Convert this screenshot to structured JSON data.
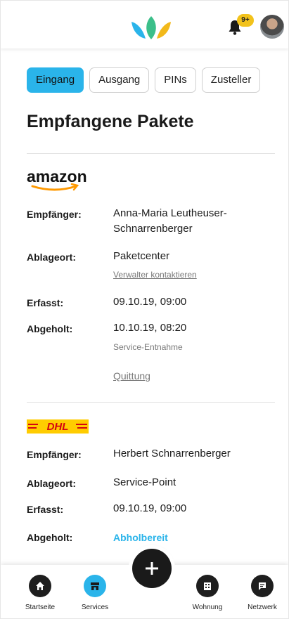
{
  "header": {
    "notification_badge": "9+",
    "icons": [
      "lotus-logo",
      "bell-icon",
      "avatar"
    ]
  },
  "tabs": [
    {
      "label": "Eingang",
      "active": true
    },
    {
      "label": "Ausgang",
      "active": false
    },
    {
      "label": "PINs",
      "active": false
    },
    {
      "label": "Zusteller",
      "active": false
    }
  ],
  "page_title": "Empfangene Pakete",
  "packages": [
    {
      "brand": "amazon",
      "recipient_label": "Empfänger:",
      "recipient": "Anna-Maria Leutheuser-Schnarrenberger",
      "location_label": "Ablageort:",
      "location": "Paketcenter",
      "location_link": "Verwalter kontaktieren",
      "recorded_label": "Erfasst:",
      "recorded": "09.10.19, 09:00",
      "picked_label": "Abgeholt:",
      "picked": "10.10.19, 08:20",
      "picked_note": "Service-Entnahme",
      "receipt_link": "Quittung"
    },
    {
      "brand": "DHL",
      "recipient_label": "Empfänger:",
      "recipient": "Herbert Schnarrenberger",
      "location_label": "Ablageort:",
      "location": "Service-Point",
      "recorded_label": "Erfasst:",
      "recorded": "09.10.19, 09:00",
      "picked_label": "Abgeholt:",
      "status": "Abholbereit"
    }
  ],
  "bottom_nav": [
    {
      "label": "Startseite",
      "icon": "home-icon",
      "active": false
    },
    {
      "label": "Services",
      "icon": "store-icon",
      "active": true
    },
    {
      "label": "",
      "icon": "plus-icon",
      "active": false
    },
    {
      "label": "Wohnung",
      "icon": "building-icon",
      "active": false
    },
    {
      "label": "Netzwerk",
      "icon": "chat-icon",
      "active": false
    }
  ],
  "colors": {
    "accent": "#2ab4ea",
    "badge": "#f2c21b",
    "dhl_yellow": "#ffcc00",
    "dhl_red": "#d40511"
  }
}
